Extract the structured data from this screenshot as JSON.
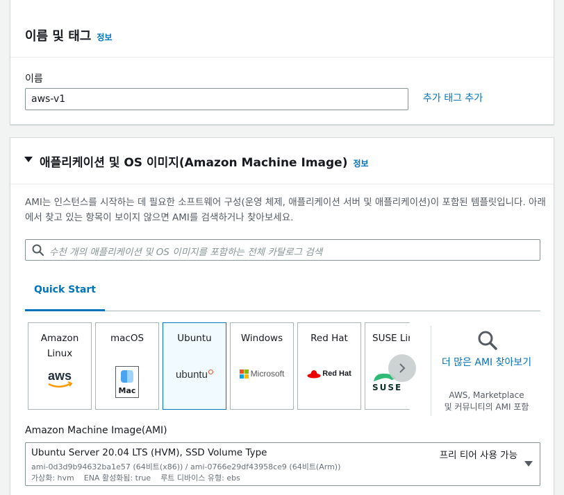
{
  "name_section": {
    "title": "이름 및 태그",
    "info": "정보",
    "name_label": "이름",
    "name_value": "aws-v1",
    "add_tag": "추가 태그 추가"
  },
  "ami_section": {
    "title": "애플리케이션 및 OS 이미지(Amazon Machine Image)",
    "info": "정보",
    "description": "AMI는 인스턴스를 시작하는 데 필요한 소프트웨어 구성(운영 체제, 애플리케이션 서버 및 애플리케이션)이 포함된 템플릿입니다. 아래에서 찾고 있는 항목이 보이지 않으면 AMI를 검색하거나 찾아보세요.",
    "search_placeholder": "수천 개의 애플리케이션 및 OS 이미지를 포함하는 전체 카탈로그 검색",
    "tab": "Quick Start",
    "tiles": [
      {
        "name": "Amazon Linux",
        "logo": "aws"
      },
      {
        "name": "macOS",
        "logo": "Mac"
      },
      {
        "name": "Ubuntu",
        "logo": "ubuntu"
      },
      {
        "name": "Windows",
        "logo": "Microsoft"
      },
      {
        "name": "Red Hat",
        "logo": "Red Hat"
      },
      {
        "name": "SUSE Lin",
        "logo": "SUSE"
      }
    ],
    "selected_tile": "Ubuntu",
    "more_link": "더 많은 AMI 찾아보기",
    "more_desc": "AWS, Marketplace 및 커뮤니티의 AMI 포함",
    "ami_label": "Amazon Machine Image(AMI)",
    "ami_name": "Ubuntu Server 20.04 LTS (HVM), SSD Volume Type",
    "ami_ids": "ami-0d3d9b94632ba1e57 (64비트(x86)) / ami-0766e29df43958ce9 (64비트(Arm))",
    "ami_meta": "가상화: hvm    ENA 활성화됨: true    루트 디바이스 유형: ebs",
    "free_tier": "프리 티어 사용 가능"
  },
  "colors": {
    "link": "#0073bb",
    "selected_bg": "#f1faff"
  }
}
